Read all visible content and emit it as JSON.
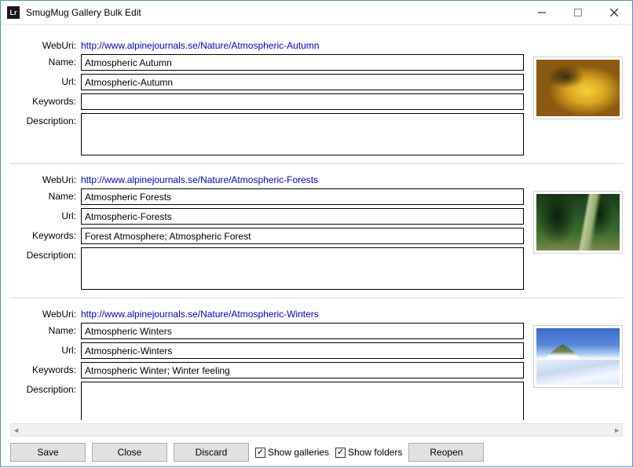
{
  "window": {
    "title": "SmugMug Gallery Bulk Edit",
    "icon_text": "Lr"
  },
  "labels": {
    "weburi": "WebUri:",
    "name": "Name:",
    "url": "Url:",
    "keywords": "Keywords:",
    "description": "Description:"
  },
  "galleries": [
    {
      "weburi": "http://www.alpinejournals.se/Nature/Atmospheric-Autumn",
      "name": "Atmospheric Autumn",
      "url": "Atmospheric-Autumn",
      "keywords": "",
      "description": "",
      "thumb_class": "th-autumn"
    },
    {
      "weburi": "http://www.alpinejournals.se/Nature/Atmospheric-Forests",
      "name": "Atmospheric Forests",
      "url": "Atmospheric-Forests",
      "keywords": "Forest Atmosphere; Atmospheric Forest",
      "description": "",
      "thumb_class": "th-forest"
    },
    {
      "weburi": "http://www.alpinejournals.se/Nature/Atmospheric-Winters",
      "name": "Atmospheric Winters",
      "url": "Atmospheric-Winters",
      "keywords": "Atmospheric Winter; Winter feeling",
      "description": "",
      "thumb_class": "th-winter"
    }
  ],
  "buttons": {
    "save": "Save",
    "close": "Close",
    "discard": "Discard",
    "reopen": "Reopen"
  },
  "checks": {
    "show_galleries": "Show galleries",
    "show_folders": "Show folders",
    "show_galleries_checked": true,
    "show_folders_checked": true
  }
}
